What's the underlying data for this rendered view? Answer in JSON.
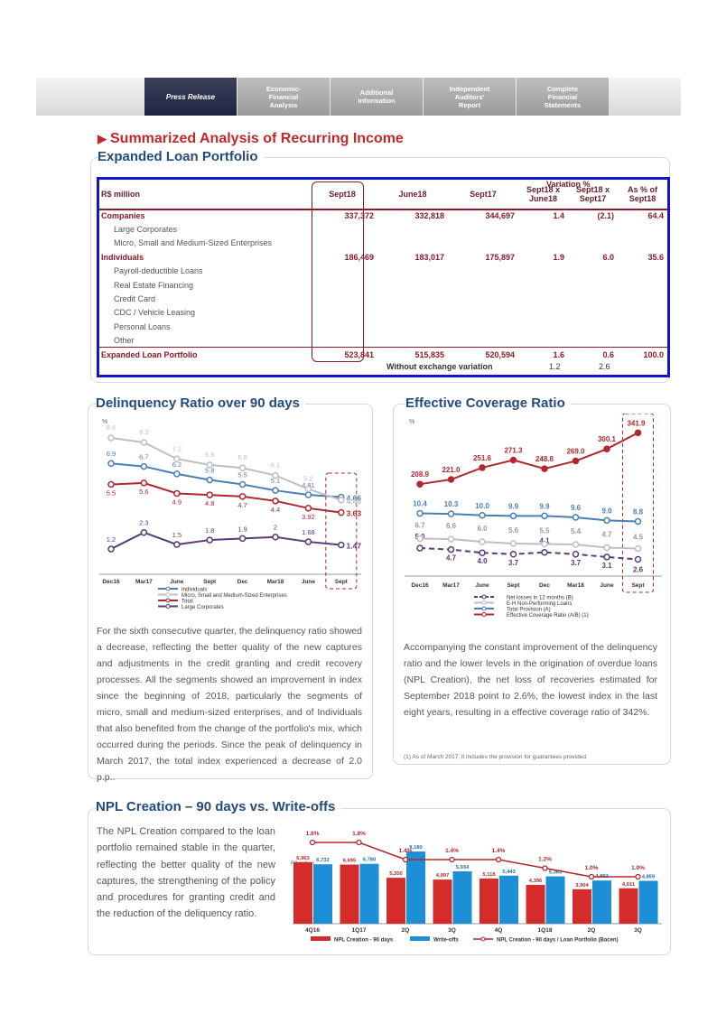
{
  "nav": {
    "tabs": [
      {
        "label": "Press Release",
        "active": true
      },
      {
        "label": "Economic-\nFinancial\nAnalysis",
        "active": false
      },
      {
        "label": "Additional\nInformation",
        "active": false
      },
      {
        "label": "Independent\nAuditors'\nReport",
        "active": false
      },
      {
        "label": "Complete\nFinancial\nStatements",
        "active": false
      }
    ]
  },
  "page": {
    "title": "Summarized Analysis of Recurring Income",
    "section_loan": "Expanded Loan Portfolio"
  },
  "loan_table": {
    "headers": [
      "R$ million",
      "Sept18",
      "June18",
      "Sept17",
      "Sept18 x June18",
      "Sept18 x Sept17",
      "As % of Sept18"
    ],
    "variation_label": "Variation %",
    "rows": [
      {
        "label": "Companies",
        "style": "bold",
        "values": [
          "337,372",
          "332,818",
          "344,697",
          "1.4",
          "(2.1)",
          "64.4"
        ]
      },
      {
        "label": "Large Corporates",
        "style": "sub",
        "values": [
          "",
          "",
          "",
          "",
          "",
          ""
        ]
      },
      {
        "label": "Micro, Small and Medium-Sized Enterprises",
        "style": "sub",
        "values": [
          "",
          "",
          "",
          "",
          "",
          ""
        ]
      },
      {
        "label": "Individuals",
        "style": "bold",
        "values": [
          "186,469",
          "183,017",
          "175,897",
          "1.9",
          "6.0",
          "35.6"
        ]
      },
      {
        "label": "Payroll-deductible Loans",
        "style": "sub",
        "values": [
          "",
          "",
          "",
          "",
          "",
          ""
        ]
      },
      {
        "label": "Real Estate Financing",
        "style": "sub",
        "values": [
          "",
          "",
          "",
          "",
          "",
          ""
        ]
      },
      {
        "label": "Credit Card",
        "style": "sub",
        "values": [
          "",
          "",
          "",
          "",
          "",
          ""
        ]
      },
      {
        "label": "CDC / Vehicle Leasing",
        "style": "sub",
        "values": [
          "",
          "",
          "",
          "",
          "",
          ""
        ]
      },
      {
        "label": "Personal Loans",
        "style": "sub",
        "values": [
          "",
          "",
          "",
          "",
          "",
          ""
        ]
      },
      {
        "label": "Other",
        "style": "sub",
        "values": [
          "",
          "",
          "",
          "",
          "",
          ""
        ]
      },
      {
        "label": "Expanded Loan Portfolio",
        "style": "total",
        "values": [
          "523,841",
          "515,835",
          "520,594",
          "1.6",
          "0.6",
          "100.0"
        ]
      }
    ],
    "note": "Without exchange variation",
    "note_values": [
      "1.2",
      "2.6"
    ]
  },
  "delinquency": {
    "title": "Delinquency Ratio over 90 days",
    "text": "For the sixth consecutive quarter, the delinquency ratio showed a decrease, reflecting the better quality of the new captures and adjustments in the credit granting and credit recovery processes. All the segments showed an improvement in index since the beginning of 2018, particularly the segments of micro, small and medium-sized enterprises, and of Individuals that also benefited from the change of the portfolio's mix, which occurred during the periods. Since the peak of delinquency in March 2017, the total index experienced a decrease of 2.0 p.p.."
  },
  "coverage": {
    "title": "Effective Coverage Ratio",
    "text": "Accompanying the constant improvement of the delinquency ratio and the lower levels in the origination of overdue loans (NPL Creation), the net loss of recoveries estimated for September 2018 point to 2.6%, the lowest index in the last eight years, resulting in a effective coverage ratio of 342%.",
    "footnote": "(1) As of March 2017, it includes the provision for guarantees provided."
  },
  "npl": {
    "title": "NPL Creation – 90 days vs. Write-offs",
    "text": "The NPL Creation compared to the loan portfolio remained stable in the quarter, reflecting the better quality of the new captures, the strengthening of the policy and procedures for granting credit and the reduction of the deliquency ratio."
  },
  "chart_data": [
    {
      "type": "line",
      "unit_label": "%",
      "categories": [
        "Dec16",
        "Mar17",
        "June",
        "Sept",
        "Dec",
        "Mar18",
        "June",
        "Sept"
      ],
      "series": [
        {
          "name": "Individuals",
          "color": "#4a7fb5",
          "values": [
            6.9,
            6.7,
            6.2,
            5.8,
            5.5,
            5.1,
            4.81,
            4.66
          ]
        },
        {
          "name": "Micro, Small and Medium-Sized Enterprises",
          "color": "#bfbfbf",
          "values": [
            8.6,
            8.3,
            7.2,
            6.8,
            6.6,
            6.1,
            5.2,
            4.46
          ]
        },
        {
          "name": "Total",
          "color": "#b0282d",
          "values": [
            5.5,
            5.6,
            4.9,
            4.8,
            4.7,
            4.4,
            3.92,
            3.63
          ]
        },
        {
          "name": "Large Corporates",
          "color": "#5b3a7a",
          "values": [
            1.2,
            2.3,
            1.5,
            1.8,
            1.9,
            2.0,
            1.68,
            1.47
          ]
        }
      ],
      "ylim": [
        0,
        9.5
      ]
    },
    {
      "type": "line",
      "unit_label": "%",
      "categories": [
        "Dec16",
        "Mar17",
        "June",
        "Sept",
        "Dec",
        "Mar18",
        "June",
        "Sept"
      ],
      "series": [
        {
          "name": "Net losses in 12 months (B)",
          "color": "#5b3a7a",
          "dashed": true,
          "values": [
            5.0,
            4.7,
            4.0,
            3.7,
            4.1,
            3.7,
            3.1,
            2.6
          ]
        },
        {
          "name": "E-H Non-Performing Loans",
          "color": "#bfbfbf",
          "values": [
            6.7,
            6.6,
            6.0,
            5.6,
            5.5,
            5.4,
            4.7,
            4.5
          ]
        },
        {
          "name": "Total Provision (A)",
          "color": "#4a7fb5",
          "values": [
            10.4,
            10.3,
            10.0,
            9.9,
            9.9,
            9.6,
            9.0,
            8.8
          ]
        },
        {
          "name": "Effective Coverage Ratio (A/B) (1)",
          "color": "#b0282d",
          "values": [
            208.9,
            221.0,
            251.6,
            271.3,
            248.8,
            269.0,
            300.1,
            341.9
          ]
        }
      ]
    },
    {
      "type": "bar",
      "unit_label": "R$ million",
      "categories": [
        "4Q16",
        "1Q17",
        "2Q",
        "3Q",
        "4Q",
        "1Q18",
        "2Q",
        "3Q"
      ],
      "series": [
        {
          "name": "NPL Creation - 90 days",
          "color": "#d42b2b",
          "values": [
            6963,
            6695,
            5200,
            4997,
            5118,
            4396,
            3904,
            4011
          ]
        },
        {
          "name": "Write-offs",
          "color": "#1d8fd6",
          "values": [
            6732,
            6780,
            8180,
            5934,
            5443,
            5363,
            4892,
            4859
          ]
        },
        {
          "name": "NPL Creation - 90 days / Loan Portfolio (Bacen)",
          "color": "#b0282d",
          "type": "line",
          "values": [
            1.8,
            1.8,
            1.4,
            1.4,
            1.4,
            1.2,
            1.0,
            1.0
          ],
          "labels": [
            "1.8%",
            "1.8%",
            "1.4%",
            "1.4%",
            "1.4%",
            "1.2%",
            "1.0%",
            "1.0%"
          ]
        }
      ]
    }
  ]
}
